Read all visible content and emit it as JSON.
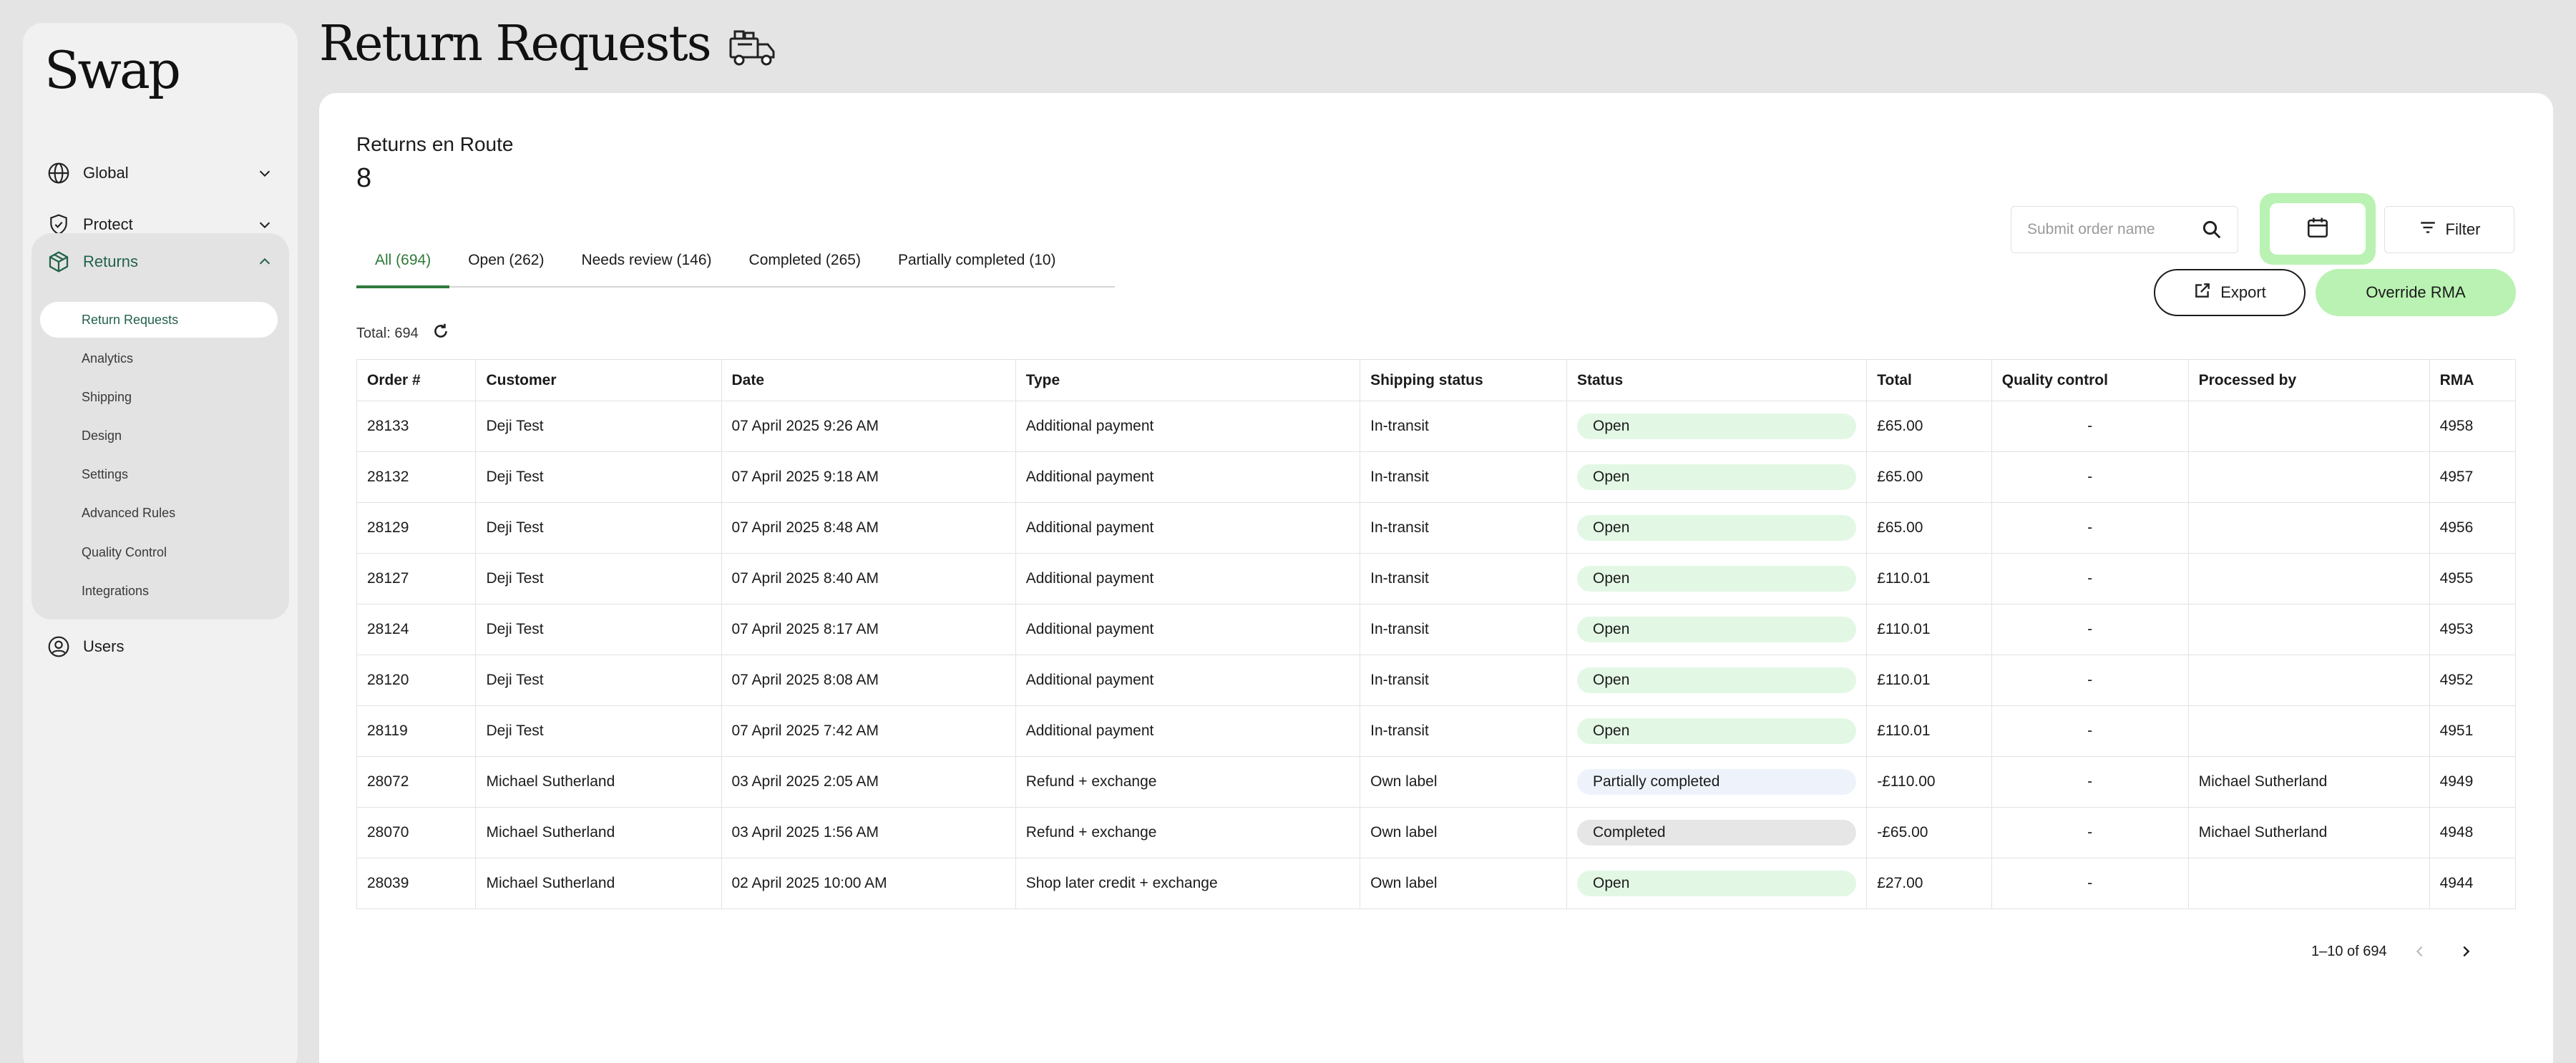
{
  "app": {
    "logo": "Swap"
  },
  "sidebar": {
    "top_items": [
      {
        "label": "Global",
        "icon": "globe-icon"
      },
      {
        "label": "Protect",
        "icon": "shield-check-icon"
      }
    ],
    "returns": {
      "label": "Returns",
      "icon": "box-icon",
      "subitems": [
        "Return Requests",
        "Analytics",
        "Shipping",
        "Design",
        "Settings",
        "Advanced Rules",
        "Quality Control",
        "Integrations"
      ],
      "active": "Return Requests"
    },
    "users": {
      "label": "Users",
      "icon": "user-circle-icon"
    }
  },
  "page": {
    "title": "Return Requests",
    "title_icon": "delivery-truck-icon"
  },
  "summary": {
    "label": "Returns en Route",
    "count": "8"
  },
  "tabs": [
    {
      "label": "All (694)",
      "active": true
    },
    {
      "label": "Open (262)",
      "active": false
    },
    {
      "label": "Needs review (146)",
      "active": false
    },
    {
      "label": "Completed (265)",
      "active": false
    },
    {
      "label": "Partially completed (10)",
      "active": false
    }
  ],
  "search": {
    "placeholder": "Submit order name"
  },
  "toolbar": {
    "filter_label": "Filter",
    "export_label": "Export",
    "override_label": "Override RMA"
  },
  "total_text": "Total: 694",
  "table": {
    "columns": [
      "Order #",
      "Customer",
      "Date",
      "Type",
      "Shipping status",
      "Status",
      "Total",
      "Quality control",
      "Processed by",
      "RMA"
    ],
    "rows": [
      [
        "28133",
        "Deji Test",
        "07 April 2025 9:26 AM",
        "Additional payment",
        "In-transit",
        "Open",
        "£65.00",
        "-",
        "",
        "4958"
      ],
      [
        "28132",
        "Deji Test",
        "07 April 2025 9:18 AM",
        "Additional payment",
        "In-transit",
        "Open",
        "£65.00",
        "-",
        "",
        "4957"
      ],
      [
        "28129",
        "Deji Test",
        "07 April 2025 8:48 AM",
        "Additional payment",
        "In-transit",
        "Open",
        "£65.00",
        "-",
        "",
        "4956"
      ],
      [
        "28127",
        "Deji Test",
        "07 April 2025 8:40 AM",
        "Additional payment",
        "In-transit",
        "Open",
        "£110.01",
        "-",
        "",
        "4955"
      ],
      [
        "28124",
        "Deji Test",
        "07 April 2025 8:17 AM",
        "Additional payment",
        "In-transit",
        "Open",
        "£110.01",
        "-",
        "",
        "4953"
      ],
      [
        "28120",
        "Deji Test",
        "07 April 2025 8:08 AM",
        "Additional payment",
        "In-transit",
        "Open",
        "£110.01",
        "-",
        "",
        "4952"
      ],
      [
        "28119",
        "Deji Test",
        "07 April 2025 7:42 AM",
        "Additional payment",
        "In-transit",
        "Open",
        "£110.01",
        "-",
        "",
        "4951"
      ],
      [
        "28072",
        "Michael Sutherland",
        "03 April 2025 2:05 AM",
        "Refund + exchange",
        "Own label",
        "Partially completed",
        "-£110.00",
        "-",
        "Michael Sutherland",
        "4949"
      ],
      [
        "28070",
        "Michael Sutherland",
        "03 April 2025 1:56 AM",
        "Refund + exchange",
        "Own label",
        "Completed",
        "-£65.00",
        "-",
        "Michael Sutherland",
        "4948"
      ],
      [
        "28039",
        "Michael Sutherland",
        "02 April 2025 10:00 AM",
        "Shop later credit + exchange",
        "Own label",
        "Open",
        "£27.00",
        "-",
        "",
        "4944"
      ]
    ]
  },
  "status_colors": {
    "Open": "#e3f7e5",
    "Partially completed": "#eef3fb",
    "Completed": "#e6e6e6"
  },
  "pagination": {
    "text": "1–10 of 694"
  },
  "colors": {
    "accent_green": "#b9f2b2",
    "active_tab": "#2f7a3a",
    "nav_active": "#23624a"
  }
}
